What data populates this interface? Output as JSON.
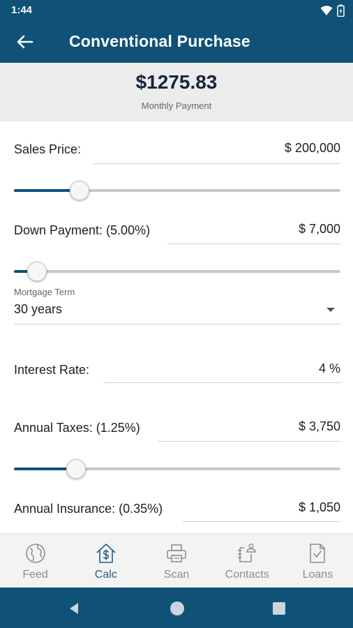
{
  "status_bar": {
    "time": "1:44"
  },
  "app_bar": {
    "title": "Conventional Purchase"
  },
  "summary": {
    "amount": "$1275.83",
    "label": "Monthly Payment"
  },
  "form": {
    "sales_price": {
      "label": "Sales Price:",
      "value": "$ 200,000",
      "slider_fraction": 0.2
    },
    "down_payment": {
      "label": "Down Payment: (5.00%)",
      "value": "$ 7,000",
      "slider_fraction": 0.07
    },
    "mortgage_term": {
      "caption": "Mortgage Term",
      "value": "30 years"
    },
    "interest_rate": {
      "label": "Interest Rate:",
      "value": "4 %"
    },
    "annual_taxes": {
      "label": "Annual Taxes: (1.25%)",
      "value": "$ 3,750",
      "slider_fraction": 0.19
    },
    "annual_insurance": {
      "label": "Annual Insurance: (0.35%)",
      "value": "$ 1,050"
    }
  },
  "bottom_nav": {
    "items": [
      {
        "label": "Feed",
        "icon": "globe-icon",
        "active": false
      },
      {
        "label": "Calc",
        "icon": "house-dollar-icon",
        "active": true
      },
      {
        "label": "Scan",
        "icon": "printer-icon",
        "active": false
      },
      {
        "label": "Contacts",
        "icon": "contacts-icon",
        "active": false
      },
      {
        "label": "Loans",
        "icon": "document-check-icon",
        "active": false
      }
    ]
  },
  "colors": {
    "primary": "#0f5177",
    "active_nav": "#1f5e88",
    "inactive_nav": "#8d8d8d",
    "summary_bg": "#ececec"
  }
}
